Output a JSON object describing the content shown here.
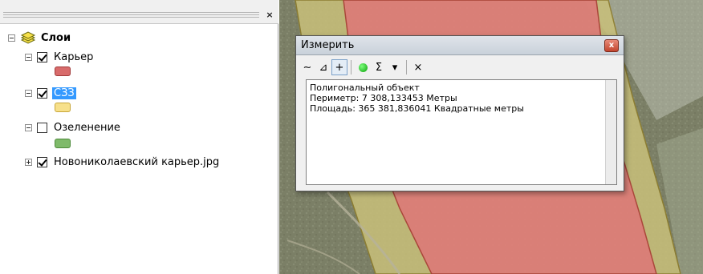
{
  "toc": {
    "close_label": "×",
    "root": {
      "label": "Слои"
    },
    "layers": [
      {
        "label": "Карьер",
        "checked": true,
        "selected": false,
        "swatch": "#d86b6b",
        "swatch_border": "#a13a3a"
      },
      {
        "label": "СЗЗ",
        "checked": true,
        "selected": true,
        "swatch": "#f7e08a",
        "swatch_border": "#c7a63a"
      },
      {
        "label": "Озеленение",
        "checked": false,
        "selected": false,
        "swatch": "#7fba6a",
        "swatch_border": "#4d8a3a"
      },
      {
        "label": "Новониколаевский карьер.jpg",
        "checked": true,
        "selected": false
      }
    ]
  },
  "measure": {
    "title": "Измерить",
    "close_label": "x",
    "toolbar": {
      "line_glyph": "∼",
      "area_glyph": "⊿",
      "feature_glyph": "+",
      "sum_glyph": "Σ",
      "units_glyph": "▾",
      "clear_glyph": "×"
    },
    "output": [
      "Полигональный объект",
      "Периметр: 7 308,133453 Метры",
      "Площадь: 365 381,836041 Квадратные метры"
    ]
  },
  "map": {
    "colors": {
      "quarry": "#dd7a78",
      "buffer": "#c9c07a",
      "terrain": "#7d8168"
    }
  }
}
